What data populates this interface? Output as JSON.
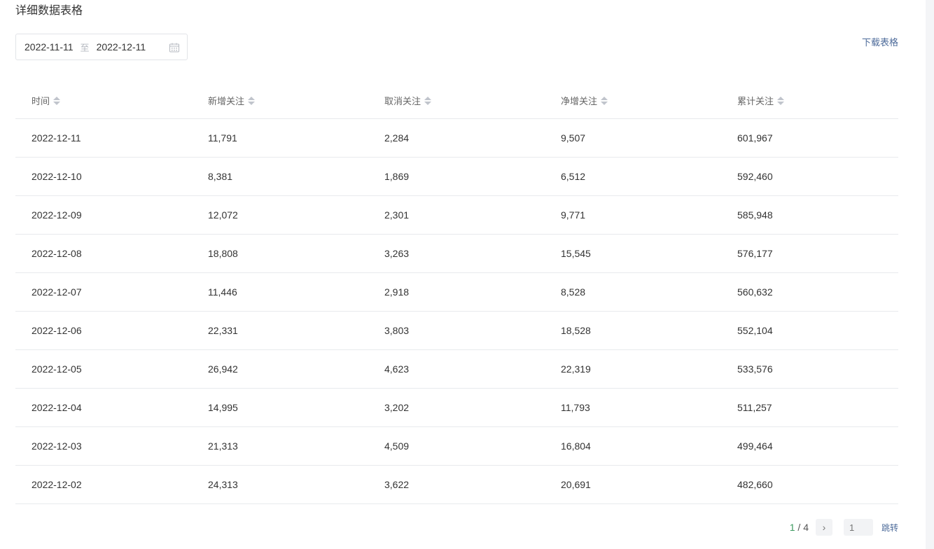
{
  "section": {
    "title": "详细数据表格"
  },
  "date_range": {
    "start": "2022-11-11",
    "separator": "至",
    "end": "2022-12-11"
  },
  "toolbar": {
    "download_label": "下载表格"
  },
  "table": {
    "columns": [
      "时间",
      "新增关注",
      "取消关注",
      "净增关注",
      "累计关注"
    ],
    "rows": [
      [
        "2022-12-11",
        "11,791",
        "2,284",
        "9,507",
        "601,967"
      ],
      [
        "2022-12-10",
        "8,381",
        "1,869",
        "6,512",
        "592,460"
      ],
      [
        "2022-12-09",
        "12,072",
        "2,301",
        "9,771",
        "585,948"
      ],
      [
        "2022-12-08",
        "18,808",
        "3,263",
        "15,545",
        "576,177"
      ],
      [
        "2022-12-07",
        "11,446",
        "2,918",
        "8,528",
        "560,632"
      ],
      [
        "2022-12-06",
        "22,331",
        "3,803",
        "18,528",
        "552,104"
      ],
      [
        "2022-12-05",
        "26,942",
        "4,623",
        "22,319",
        "533,576"
      ],
      [
        "2022-12-04",
        "14,995",
        "3,202",
        "11,793",
        "511,257"
      ],
      [
        "2022-12-03",
        "21,313",
        "4,509",
        "16,804",
        "499,464"
      ],
      [
        "2022-12-02",
        "24,313",
        "3,622",
        "20,691",
        "482,660"
      ]
    ]
  },
  "pagination": {
    "current_page": "1",
    "separator": " / ",
    "total_pages": "4",
    "next_icon": "chevron-right-icon",
    "next_glyph": "›",
    "jump_placeholder": "1",
    "jump_label": "跳转"
  }
}
